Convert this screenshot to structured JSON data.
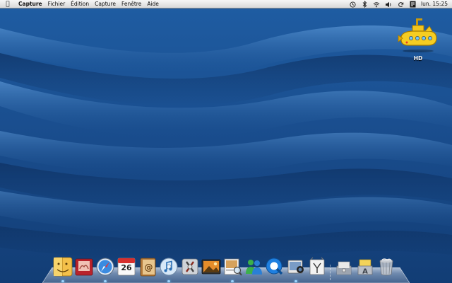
{
  "menubar": {
    "apple_icon": "apple-logo",
    "app_name": "Capture",
    "menus": [
      "Fichier",
      "Édition",
      "Capture",
      "Fenêtre",
      "Aide"
    ],
    "status_icons": [
      "time-machine-icon",
      "bluetooth-icon",
      "wifi-icon",
      "volume-icon",
      "sync-icon",
      "input-menu-icon"
    ],
    "clock": "lun. 15:25"
  },
  "desktop": {
    "wallpaper": "blue-waves",
    "drive": {
      "label": "HD",
      "icon": "yellow-submarine-icon"
    }
  },
  "dock": {
    "items": [
      {
        "name": "finder",
        "icon": "finder-icon",
        "running": true
      },
      {
        "name": "photo-booth",
        "icon": "photo-booth-icon",
        "running": false
      },
      {
        "name": "safari",
        "icon": "safari-icon",
        "running": true
      },
      {
        "name": "ical",
        "icon": "calendar-icon",
        "running": false,
        "date": "26"
      },
      {
        "name": "address-book",
        "icon": "address-book-icon",
        "running": false
      },
      {
        "name": "itunes",
        "icon": "itunes-icon",
        "running": true
      },
      {
        "name": "system-preferences",
        "icon": "system-preferences-icon",
        "running": false
      },
      {
        "name": "iphoto",
        "icon": "iphoto-icon",
        "running": false
      },
      {
        "name": "preview",
        "icon": "preview-icon",
        "running": true
      },
      {
        "name": "messenger",
        "icon": "messenger-icon",
        "running": false
      },
      {
        "name": "quicktime",
        "icon": "quicktime-icon",
        "running": false
      },
      {
        "name": "capture",
        "icon": "capture-icon",
        "running": true
      },
      {
        "name": "dashboard",
        "icon": "dashboard-icon",
        "running": false
      }
    ],
    "stacks": [
      {
        "name": "documents",
        "icon": "documents-stack-icon"
      },
      {
        "name": "applications",
        "icon": "applications-stack-icon"
      },
      {
        "name": "trash",
        "icon": "trash-icon"
      }
    ]
  }
}
